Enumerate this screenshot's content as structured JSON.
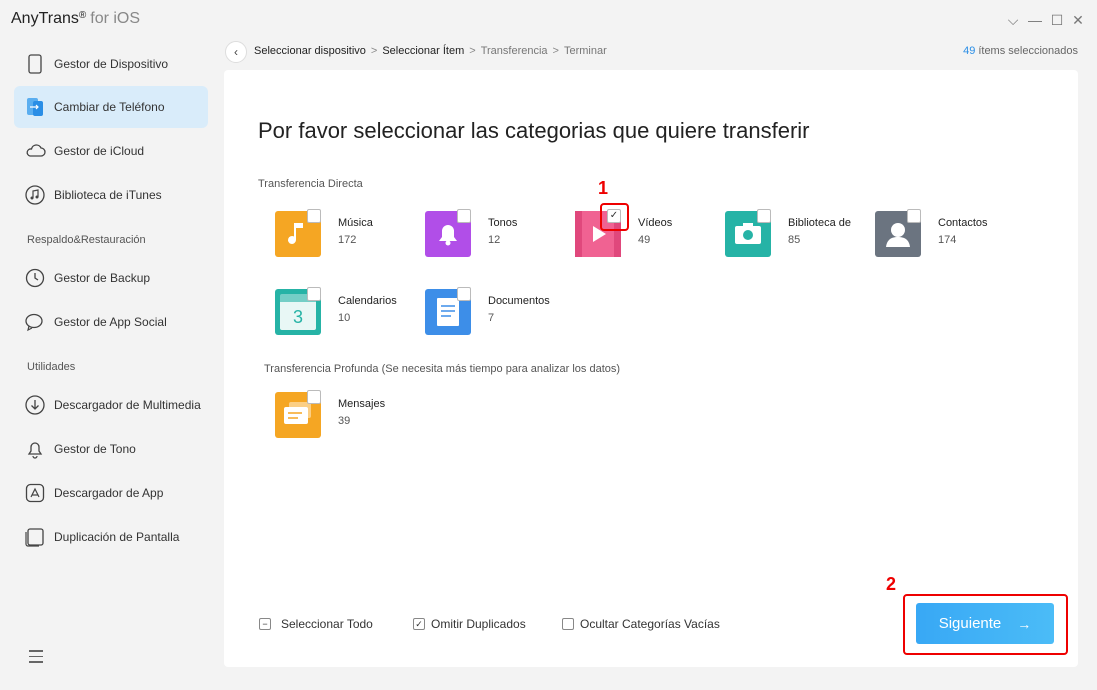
{
  "app": {
    "name": "AnyTrans",
    "reg": "®",
    "suffix": "for iOS"
  },
  "window_controls": [
    "⌵",
    "—",
    "☐",
    "✕"
  ],
  "sidebar": {
    "items": [
      {
        "label": "Gestor de Dispositivo",
        "icon": "device-icon"
      },
      {
        "label": "Cambiar de Teléfono",
        "icon": "phone-switch-icon",
        "active": true
      },
      {
        "label": "Gestor de iCloud",
        "icon": "cloud-icon"
      },
      {
        "label": "Biblioteca de iTunes",
        "icon": "itunes-icon"
      }
    ],
    "section_backup": "Respaldo&Restauración",
    "backup_items": [
      {
        "label": "Gestor de Backup",
        "icon": "backup-icon"
      },
      {
        "label": "Gestor de App Social",
        "icon": "chat-icon"
      }
    ],
    "section_utils": "Utilidades",
    "util_items": [
      {
        "label": "Descargador de Multimedia",
        "icon": "download-icon"
      },
      {
        "label": "Gestor de Tono",
        "icon": "bell-icon"
      },
      {
        "label": "Descargador de App",
        "icon": "app-store-icon"
      },
      {
        "label": "Duplicación de Pantalla",
        "icon": "screen-mirror-icon"
      }
    ]
  },
  "breadcrumb": {
    "steps": [
      "Seleccionar dispositivo",
      "Seleccionar Ítem",
      "Transferencia",
      "Terminar"
    ],
    "sep": ">"
  },
  "selected": {
    "count": "49",
    "label": "ítems seleccionados"
  },
  "page_title": "Por favor seleccionar las categorias que quiere transferir",
  "direct_label": "Transferencia Directa",
  "deep_label": "Transferencia Profunda (Se necesita más tiempo para analizar los datos)",
  "categories": [
    {
      "name": "Música",
      "count": "172",
      "checked": false,
      "color": "#f5a623"
    },
    {
      "name": "Tonos",
      "count": "12",
      "checked": false,
      "color": "#b14ee8"
    },
    {
      "name": "Vídeos",
      "count": "49",
      "checked": true,
      "color": "#f06292"
    },
    {
      "name": "Biblioteca de",
      "count": "85",
      "checked": false,
      "color": "#26b3a6"
    },
    {
      "name": "Contactos",
      "count": "174",
      "checked": false,
      "color": "#6b7480"
    },
    {
      "name": "Calendarios",
      "count": "10",
      "checked": false,
      "color": "#26b3a6"
    },
    {
      "name": "Documentos",
      "count": "7",
      "checked": false,
      "color": "#3d8ee8"
    }
  ],
  "deep_categories": [
    {
      "name": "Mensajes",
      "count": "39",
      "checked": false,
      "color": "#f5a623"
    }
  ],
  "annotations": {
    "one": "1",
    "two": "2"
  },
  "options": {
    "select_all": "Seleccionar Todo",
    "skip_duplicates": "Omitir Duplicados",
    "hide_empty": "Ocultar Categorías Vacías"
  },
  "check_mark": "✓",
  "minus_mark": "−",
  "next_button": {
    "label": "Siguiente",
    "arrow": "→"
  },
  "back_arrow": "‹"
}
